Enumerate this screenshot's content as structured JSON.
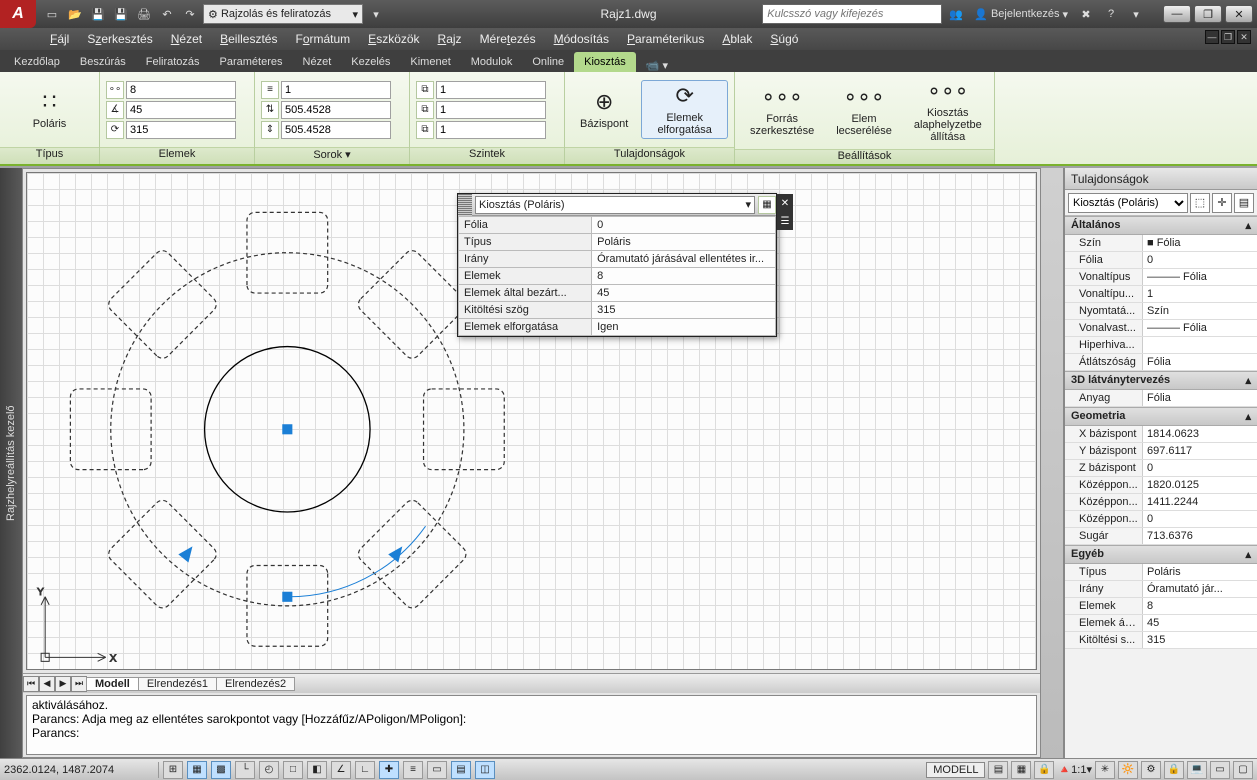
{
  "title": "Rajz1.dwg",
  "workspace_combo": "Rajzolás és feliratozás",
  "search_placeholder": "Kulcsszó vagy kifejezés",
  "signin": "Bejelentkezés",
  "menus": [
    "Fájl",
    "Szerkesztés",
    "Nézet",
    "Beillesztés",
    "Formátum",
    "Eszközök",
    "Rajz",
    "Méretezés",
    "Módosítás",
    "Paraméterikus",
    "Ablak",
    "Súgó"
  ],
  "ribbon_tabs": [
    "Kezdőlap",
    "Beszúrás",
    "Feliratozás",
    "Paraméteres",
    "Nézet",
    "Kezelés",
    "Kimenet",
    "Modulok",
    "Online",
    "Kiosztás"
  ],
  "ribbon_active": "Kiosztás",
  "panel_type": {
    "title": "Típus",
    "btn": "Poláris"
  },
  "panel_items": {
    "title": "Elemek",
    "r1": "8",
    "r2": "45",
    "r3": "315"
  },
  "panel_rows": {
    "title": "Sorok ▾",
    "r1": "1",
    "r2": "505.4528",
    "r3": "505.4528"
  },
  "panel_levels": {
    "title": "Szintek",
    "r1": "1",
    "r2": "1",
    "r3": "1"
  },
  "panel_props": {
    "title": "Tulajdonságok",
    "b1": "Bázispont",
    "b2": "Elemek elforgatása"
  },
  "panel_settings": {
    "title": "Beállítások",
    "b1": "Forrás szerkesztése",
    "b2": "Elem lecserélése",
    "b3": "Kiosztás alaphelyzetbe állítása"
  },
  "left_rail": "Rajzhelyreállítás kezelő",
  "layout_tabs": [
    "Modell",
    "Elrendezés1",
    "Elrendezés2"
  ],
  "cmd_lines": [
    "aktiválásához.",
    "Parancs: Adja meg az ellentétes sarokpontot vagy [Hozzáfűz/APoligon/MPoligon]:",
    "",
    "Parancs:"
  ],
  "coords": "2362.0124, 1487.2074",
  "quick_panel": {
    "title": "Kiosztás (Poláris)",
    "rows": [
      [
        "Fólia",
        "0"
      ],
      [
        "Típus",
        "Poláris"
      ],
      [
        "Irány",
        "Óramutató járásával ellentétes ir..."
      ],
      [
        "Elemek",
        "8"
      ],
      [
        "Elemek által bezárt...",
        "45"
      ],
      [
        "Kitöltési szög",
        "315"
      ],
      [
        "Elemek elforgatása",
        "Igen"
      ]
    ]
  },
  "props": {
    "title": "Tulajdonságok",
    "selection": "Kiosztás (Poláris)",
    "groups": [
      {
        "name": "Általános",
        "rows": [
          [
            "Szín",
            "■ Fólia"
          ],
          [
            "Fólia",
            "0"
          ],
          [
            "Vonaltípus",
            "——— Fólia"
          ],
          [
            "Vonaltípu...",
            "1"
          ],
          [
            "Nyomtatá...",
            "Szín"
          ],
          [
            "Vonalvast...",
            "——— Fólia"
          ],
          [
            "Hiperhiva...",
            ""
          ],
          [
            "Átlátszóság",
            "Fólia"
          ]
        ]
      },
      {
        "name": "3D látványtervezés",
        "rows": [
          [
            "Anyag",
            "Fólia"
          ]
        ]
      },
      {
        "name": "Geometria",
        "rows": [
          [
            "X bázispont",
            "1814.0623"
          ],
          [
            "Y bázispont",
            "697.6117"
          ],
          [
            "Z bázispont",
            "0"
          ],
          [
            "Középpon...",
            "1820.0125"
          ],
          [
            "Középpon...",
            "1411.2244"
          ],
          [
            "Középpon...",
            "0"
          ],
          [
            "Sugár",
            "713.6376"
          ]
        ]
      },
      {
        "name": "Egyéb",
        "rows": [
          [
            "Típus",
            "Poláris"
          ],
          [
            "Irány",
            "Óramutató jár..."
          ],
          [
            "Elemek",
            "8"
          ],
          [
            "Elemek ált...",
            "45"
          ],
          [
            "Kitöltési s...",
            "315"
          ]
        ]
      }
    ]
  },
  "status_right": {
    "model": "MODELL",
    "scale": "1:1"
  }
}
